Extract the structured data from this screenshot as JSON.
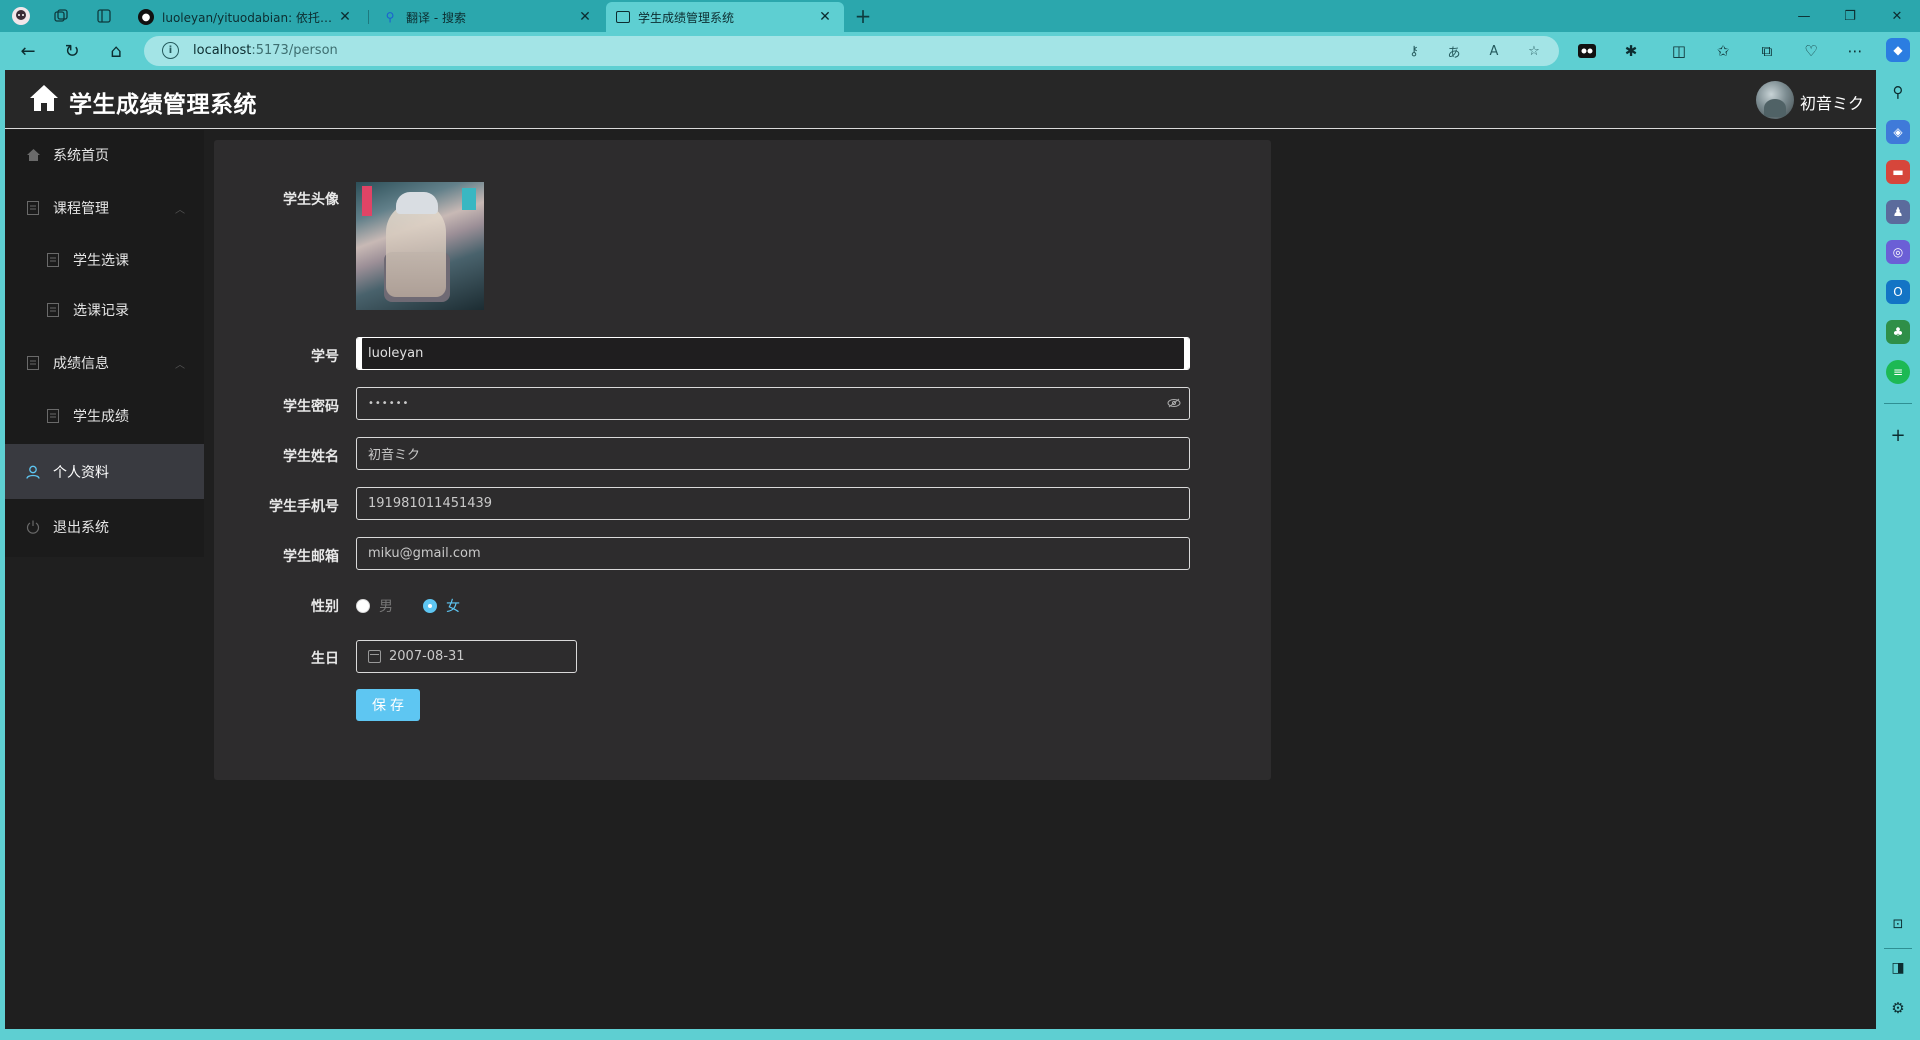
{
  "browser": {
    "tabs": [
      {
        "title": "luoleyan/yituodabian: 依托答辩🙃",
        "favicon": "github-icon"
      },
      {
        "title": "翻译 - 搜索",
        "favicon": "search-icon"
      },
      {
        "title": "学生成绩管理系统",
        "favicon": "page-icon"
      }
    ],
    "url_host": "localhost",
    "url_rest": ":5173/person",
    "colors": {
      "chrome": "#5ecfd2",
      "tabbar": "#2ba7ad"
    }
  },
  "app": {
    "title": "学生成绩管理系统",
    "user_name": "初音ミク",
    "colors": {
      "accent": "#5ec6f2",
      "header_bg": "#272727",
      "menu_bg": "#1b1b1b",
      "card_bg": "#2d2c2d"
    },
    "menu": {
      "home": "系统首页",
      "course_mgmt": "课程管理",
      "course_select": "学生选课",
      "course_records": "选课记录",
      "grade_info": "成绩信息",
      "student_grades": "学生成绩",
      "profile": "个人资料",
      "logout": "退出系统"
    },
    "form": {
      "avatar_label": "学生头像",
      "id_label": "学号",
      "id_value": "luoleyan",
      "password_label": "学生密码",
      "password_value": "••••••",
      "name_label": "学生姓名",
      "name_value": "初音ミク",
      "phone_label": "学生手机号",
      "phone_value": "191981011451439",
      "email_label": "学生邮箱",
      "email_value": "miku@gmail.com",
      "gender_label": "性别",
      "gender_male": "男",
      "gender_female": "女",
      "gender_selected": "女",
      "birthday_label": "生日",
      "birthday_value": "2007-08-31",
      "save_label": "保存"
    }
  }
}
